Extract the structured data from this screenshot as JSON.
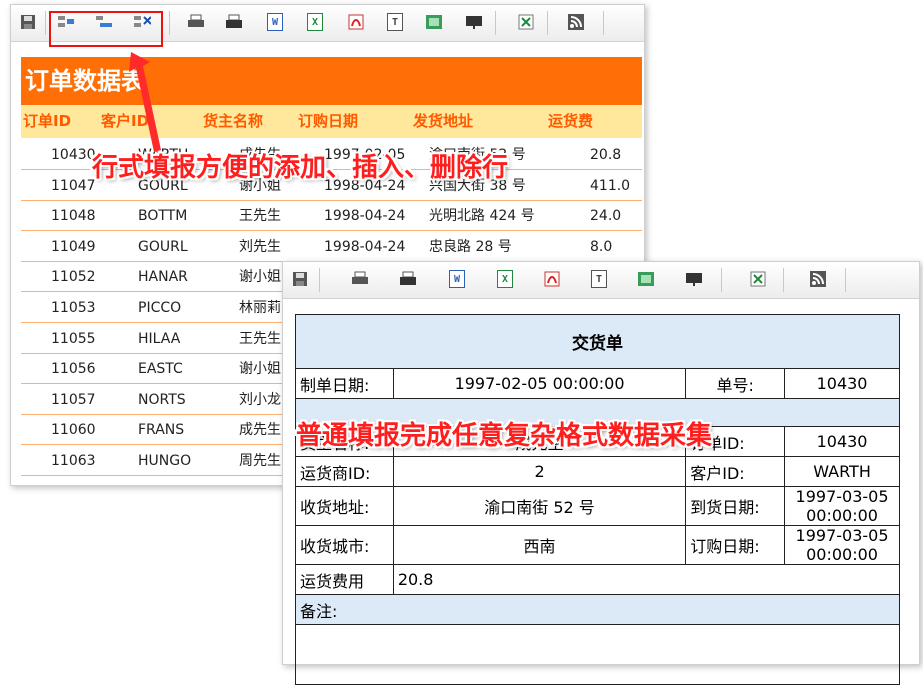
{
  "grid": {
    "title": "订单数据表",
    "columns": [
      "订单ID",
      "客户ID",
      "货主名称",
      "订购日期",
      "发货地址",
      "运货费"
    ],
    "rows": [
      [
        "10430",
        "WARTH",
        "成先生",
        "1997-02-05",
        "渝口南街 52 号",
        "20.8"
      ],
      [
        "11047",
        "GOURL",
        "谢小姐",
        "1998-04-24",
        "兴国大街 38 号",
        "411.0"
      ],
      [
        "11048",
        "BOTTM",
        "王先生",
        "1998-04-24",
        "光明北路 424 号",
        "24.0"
      ],
      [
        "11049",
        "GOURL",
        "刘先生",
        "1998-04-24",
        "忠良路 28 号",
        "8.0"
      ],
      [
        "11052",
        "HANAR",
        "谢小姐",
        "",
        "",
        ""
      ],
      [
        "11053",
        "PICCO",
        "林丽莉",
        "",
        "",
        ""
      ],
      [
        "11055",
        "HILAA",
        "王先生",
        "",
        "",
        ""
      ],
      [
        "11056",
        "EASTC",
        "谢小姐",
        "",
        "",
        ""
      ],
      [
        "11057",
        "NORTS",
        "刘小龙",
        "",
        "",
        ""
      ],
      [
        "11060",
        "FRANS",
        "成先生",
        "",
        "",
        ""
      ],
      [
        "11063",
        "HUNGO",
        "周先生",
        "",
        "",
        ""
      ]
    ]
  },
  "toolbar_a": {
    "icons": [
      "save-icon",
      "add-row-icon",
      "insert-row-icon",
      "delete-row-icon",
      "print-icon",
      "print-preview-icon",
      "export-word-icon",
      "export-excel-icon",
      "export-pdf-icon",
      "export-text-icon",
      "export-image-icon",
      "export-ppt-icon",
      "import-excel-icon",
      "rss-icon"
    ]
  },
  "toolbar_b": {
    "icons": [
      "save-icon",
      "print-icon",
      "print-preview-icon",
      "export-word-icon",
      "export-excel-icon",
      "export-pdf-icon",
      "export-text-icon",
      "export-image-icon",
      "export-ppt-icon",
      "import-excel-icon",
      "rss-icon"
    ]
  },
  "icon_letters": {
    "word": "W",
    "excel": "X",
    "text": "T"
  },
  "annotations": {
    "row_fill": "行式填报方便的添加、插入、删除行",
    "form_fill": "普通填报完成任意复杂格式数据采集"
  },
  "form": {
    "title": "交货单",
    "make_date_label": "制单日期:",
    "make_date_value": "1997-02-05 00:00:00",
    "order_no_label": "单号:",
    "order_no_value": "10430",
    "shipper_label": "货主名称:",
    "shipper_value": "成先生",
    "order_id_label": "订单ID:",
    "order_id_value": "10430",
    "carrier_label": "运货商ID:",
    "carrier_value": "2",
    "customer_label": "客户ID:",
    "customer_value": "WARTH",
    "address_label": "收货地址:",
    "address_value": "渝口南街 52 号",
    "arrive_label": "到货日期:",
    "arrive_value": "1997-03-05 00:00:00",
    "city_label": "收货城市:",
    "city_value": "西南",
    "order_date_label": "订购日期:",
    "order_date_value": "1997-03-05 00:00:00",
    "freight_label": "运货费用",
    "freight_value": "20.8",
    "remark_label": "备注:"
  },
  "colors": {
    "banner": "#ff6f05",
    "header_band": "#ffe79b",
    "header_text": "#ff5a00",
    "annotation": "#ff1e1e",
    "form_band": "#dce9f7"
  }
}
